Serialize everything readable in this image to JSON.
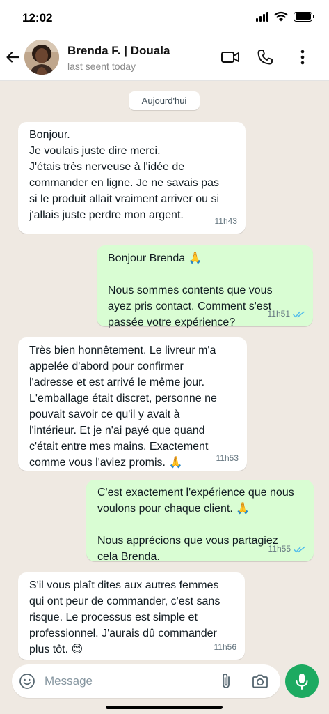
{
  "status_bar": {
    "time": "12:02",
    "icons": [
      "signal-icon",
      "wifi-icon",
      "battery-icon"
    ]
  },
  "header": {
    "contact_name": "Brenda F. | Douala",
    "contact_status": "last seent today",
    "icons": [
      "back-arrow-icon",
      "video-call-icon",
      "phone-icon",
      "more-vertical-icon"
    ]
  },
  "chat": {
    "date_label": "Aujourd'hui",
    "messages": [
      {
        "direction": "incoming",
        "text": "Bonjour.\nJe voulais juste dire merci.\nJ'étais très nerveuse à l'idée de\ncommander en ligne. Je ne savais pas\nsi le produit allait vraiment arriver ou si\nj'allais juste perdre mon argent.",
        "time": "11h43"
      },
      {
        "direction": "outgoing",
        "text": "Bonjour Brenda 🙏\n\nNous sommes contents que vous\nayez pris contact. Comment s'est\npassée votre expérience?",
        "time": "11h51",
        "status": "read"
      },
      {
        "direction": "incoming",
        "text": "Très bien honnêtement. Le livreur m'a\nappelée d'abord pour confirmer\nl'adresse et est arrivé le même jour.\nL'emballage était discret, personne ne\npouvait savoir ce qu'il y avait à\nl'intérieur. Et je n'ai payé que quand\nc'était entre mes mains. Exactement\ncomme vous l'aviez promis. 🙏",
        "time": "11h53"
      },
      {
        "direction": "outgoing",
        "text": "C'est exactement l'expérience que nous\nvoulons pour chaque client. 🙏\n\nNous apprécions que vous partagiez\ncela Brenda.",
        "time": "11h55",
        "status": "read"
      },
      {
        "direction": "incoming",
        "text": "S'il vous plaît dites aux autres femmes\nqui ont peur de commander, c'est sans\nrisque. Le processus est simple et\nprofessionnel. J'aurais dû commander\nplus tôt. 😊",
        "time": "11h56"
      }
    ]
  },
  "input": {
    "placeholder": "Message",
    "icons": [
      "emoji-icon",
      "paperclip-icon",
      "camera-icon",
      "microphone-icon"
    ]
  },
  "colors": {
    "chat_background": "#efe9e2",
    "incoming_bubble": "#ffffff",
    "outgoing_bubble": "#d9fdd3",
    "read_ticks": "#53bdeb",
    "mic_button": "#1daa61"
  }
}
